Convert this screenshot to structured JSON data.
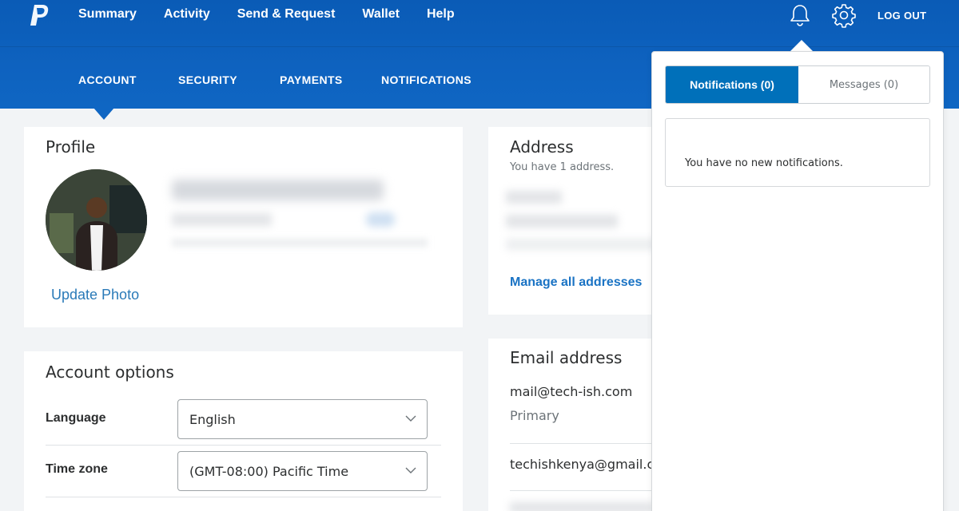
{
  "header": {
    "nav": [
      "Summary",
      "Activity",
      "Send & Request",
      "Wallet",
      "Help"
    ],
    "logout": "LOG OUT",
    "logo_icon": "paypal-logo-icon",
    "bell_icon": "bell-icon",
    "settings_icon": "gear-icon"
  },
  "subnav": {
    "tabs": [
      "ACCOUNT",
      "SECURITY",
      "PAYMENTS",
      "NOTIFICATIONS"
    ],
    "active": "ACCOUNT"
  },
  "profile": {
    "title": "Profile",
    "update_photo": "Update Photo"
  },
  "account_options": {
    "title": "Account options",
    "language_label": "Language",
    "language_value": "English",
    "timezone_label": "Time zone",
    "timezone_value": "(GMT-08:00) Pacific Time"
  },
  "address": {
    "title": "Address",
    "subtitle": "You have 1 address.",
    "manage_link": "Manage all addresses"
  },
  "email": {
    "title": "Email address",
    "primary_email": "mail@tech-ish.com",
    "primary_label": "Primary",
    "secondary_email": "techishkenya@gmail.com"
  },
  "notifications_panel": {
    "tab_notifications": "Notifications (0)",
    "tab_messages": "Messages (0)",
    "empty_text": "You have no new notifications."
  },
  "colors": {
    "header_blue": "#0f66c3",
    "accent_blue": "#0070ba",
    "link_blue": "#2a7ab8"
  }
}
